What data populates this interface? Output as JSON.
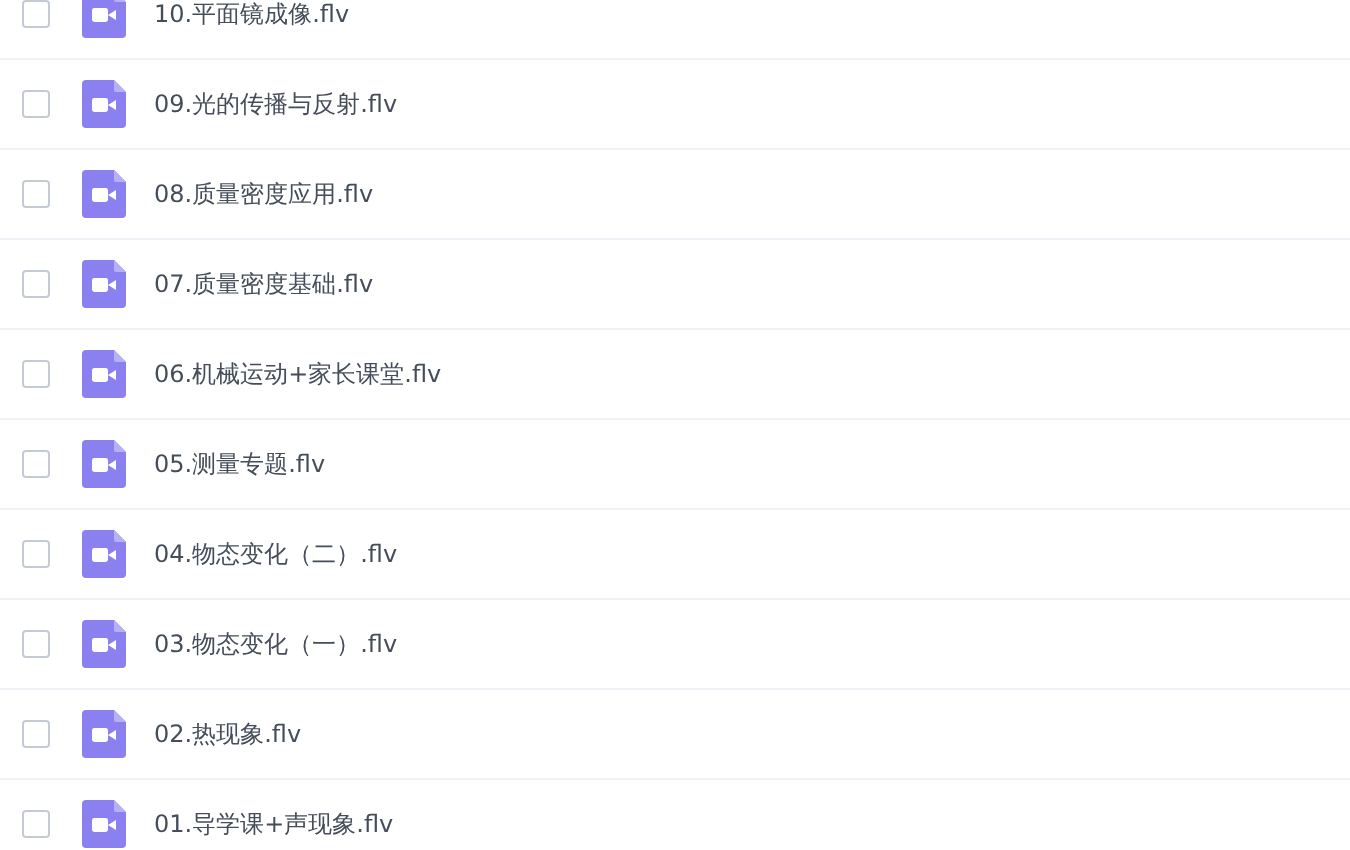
{
  "files": [
    {
      "name": "10.平面镜成像.flv",
      "checked": false
    },
    {
      "name": "09.光的传播与反射.flv",
      "checked": false
    },
    {
      "name": "08.质量密度应用.flv",
      "checked": false
    },
    {
      "name": "07.质量密度基础.flv",
      "checked": false
    },
    {
      "name": "06.机械运动+家长课堂.flv",
      "checked": false
    },
    {
      "name": "05.测量专题.flv",
      "checked": false
    },
    {
      "name": "04.物态变化（二）.flv",
      "checked": false
    },
    {
      "name": "03.物态变化（一）.flv",
      "checked": false
    },
    {
      "name": "02.热现象.flv",
      "checked": false
    },
    {
      "name": "01.导学课+声现象.flv",
      "checked": false
    }
  ]
}
